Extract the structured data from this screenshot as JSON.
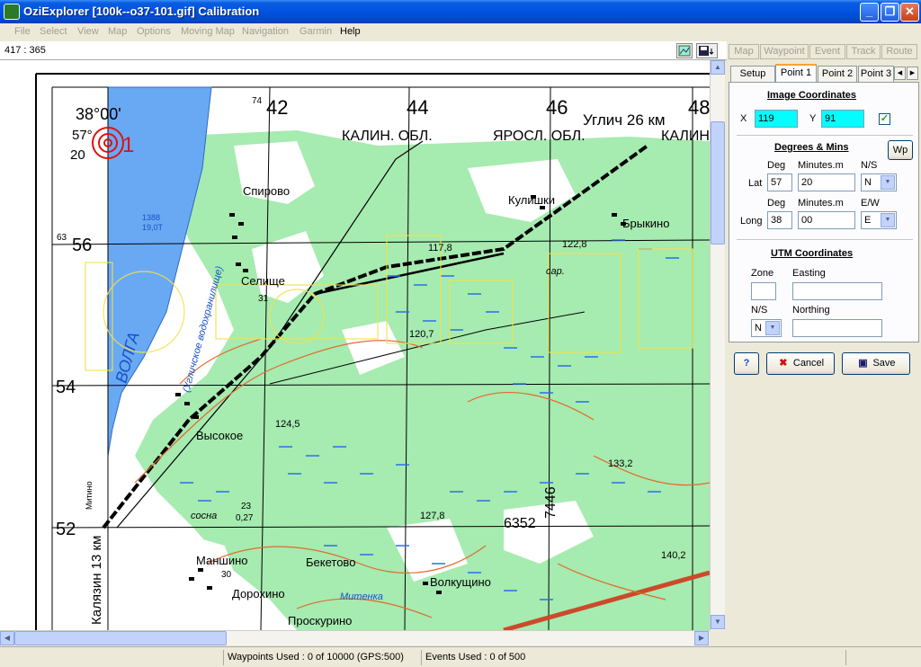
{
  "window": {
    "title": "OziExplorer [100k--o37-101.gif] Calibration"
  },
  "menu": [
    "File",
    "Select",
    "View",
    "Map",
    "Options",
    "Moving Map",
    "Navigation",
    "Garmin",
    "Help"
  ],
  "coord_readout": "417 : 365",
  "top_tabs": [
    "Map",
    "Waypoint",
    "Event",
    "Track",
    "Route"
  ],
  "panel": {
    "tabs": [
      "Setup",
      "Point 1",
      "Point 2",
      "Point 3"
    ],
    "image_coords": {
      "title": "Image Coordinates",
      "x_label": "X",
      "x_value": "119",
      "y_label": "Y",
      "y_value": "91"
    },
    "degmin": {
      "title": "Degrees & Mins",
      "wp_label": "Wp",
      "deg_label": "Deg",
      "min_label": "Minutes.m",
      "ns_label": "N/S",
      "ew_label": "E/W",
      "lat_label": "Lat",
      "lat_deg": "57",
      "lat_min": "20",
      "lat_hemi": "N",
      "long_label": "Long",
      "long_deg": "38",
      "long_min": "00",
      "long_hemi": "E"
    },
    "utm": {
      "title": "UTM Coordinates",
      "zone_label": "Zone",
      "easting_label": "Easting",
      "ns_label": "N/S",
      "ns_value": "N",
      "northing_label": "Northing",
      "zone_value": "",
      "easting_value": "",
      "northing_value": ""
    },
    "buttons": {
      "help": "?",
      "cancel": "Cancel",
      "save": "Save"
    }
  },
  "status": {
    "waypoints": "Waypoints Used : 0 of 10000  (GPS:500)",
    "events": "Events Used : 0 of 500"
  },
  "map_labels": {
    "lon": "38°00'",
    "lat1": "57°",
    "lat2": "20",
    "point_label": "1",
    "grid_top": [
      "74",
      "42",
      "44",
      "46",
      "48"
    ],
    "grid_left": [
      "63",
      "56",
      "54",
      "52"
    ],
    "header_text1": "КАЛИН. ОБЛ.",
    "header_text2": "ЯРОСЛ. ОБЛ.",
    "header_text3": "КАЛИН",
    "uglich": "Углич 26 км",
    "kalyazin": "Калязин 13 км",
    "mitino": "Митино",
    "volga": "ВОЛГА",
    "volga_sub": "(Угличское водохранилище)",
    "towns": [
      "Спирово",
      "Селище",
      "Высокое",
      "Маншино",
      "Дорохино",
      "Бекетово",
      "Волкущино",
      "Проскурино",
      "Кулишки",
      "Брыкино"
    ],
    "heights": [
      "117,8",
      "122,8",
      "120,7",
      "124,5",
      "127,8",
      "133,2",
      "140,2"
    ],
    "numbers": [
      "7446",
      "6352",
      "1388",
      "19,0Т",
      "31",
      "30",
      "23",
      "0,27"
    ],
    "extra": [
      "сосна",
      "Митенка",
      "сар."
    ]
  },
  "colors": {
    "title_blue": "#0053e0",
    "forest_green": "#9ee6a8",
    "water_blue": "#5aa0ff",
    "cyan_field": "#00ffff"
  }
}
